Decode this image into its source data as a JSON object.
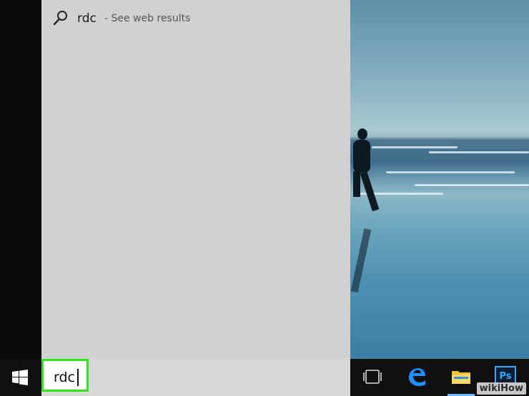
{
  "search_panel": {
    "result": {
      "query": "rdc",
      "suffix": "- See web results",
      "icon": "search-icon"
    }
  },
  "taskbar": {
    "start_icon": "windows-logo-icon",
    "search_value": "rdc",
    "task_view_icon": "task-view-icon",
    "edge_icon": "edge-icon",
    "file_explorer_icon": "file-explorer-icon",
    "photoshop_icon": "photoshop-icon",
    "photoshop_label": "Ps"
  },
  "watermark": "wikiHow",
  "colors": {
    "highlight": "#2ee81a",
    "panel": "#d1d1d1",
    "taskbar": "#101010"
  }
}
